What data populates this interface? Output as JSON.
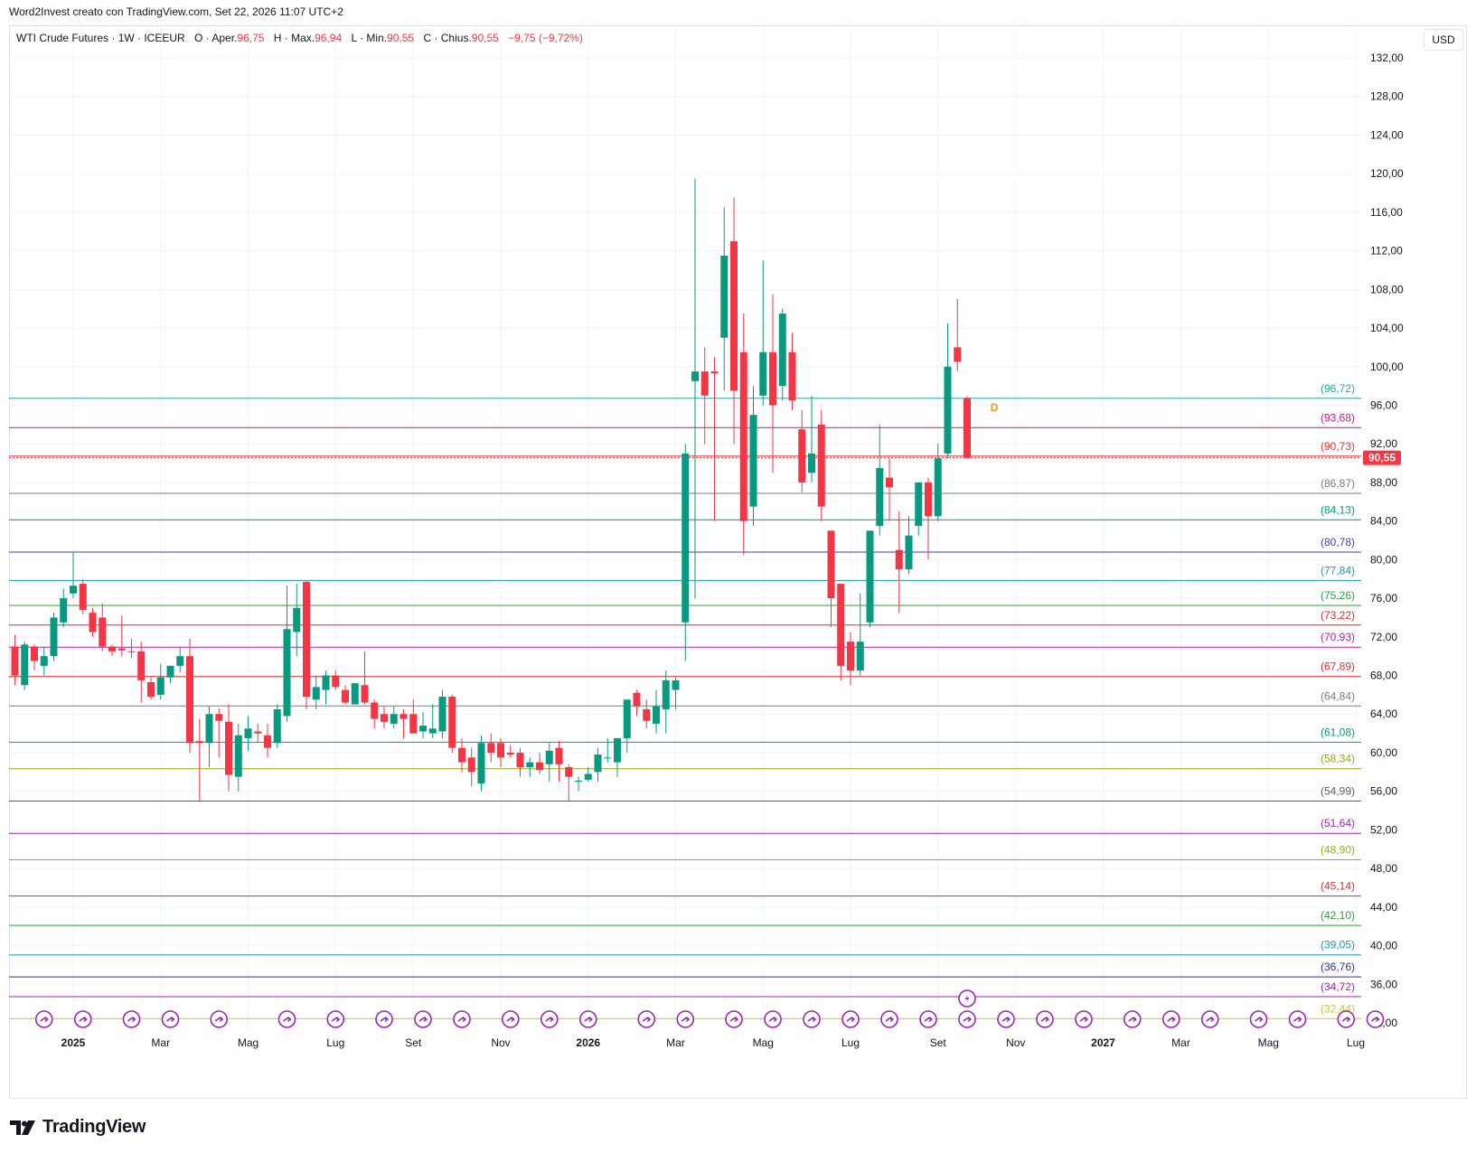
{
  "header": {
    "caption": "Word2Invest creato con TradingView.com, Set 22, 2026 11:07 UTC+2"
  },
  "legend": {
    "symbol": "WTI Crude Futures · 1W · ICEEUR",
    "open_label": "O · Aper.",
    "open_value": "96,75",
    "high_label": "H · Max.",
    "high_value": "96,94",
    "low_label": "L · Min.",
    "low_value": "90,55",
    "close_label": "C · Chius.",
    "close_value": "90,55",
    "change": "−9,75 (−9,72%)"
  },
  "currency": "USD",
  "brand": {
    "name": "TradingView"
  },
  "colors": {
    "up": "#089981",
    "down": "#f23645",
    "grid": "#f0f3fa",
    "text": "#131722",
    "marker": "#9c27b0",
    "current_price": "#f23645"
  },
  "chart_data": {
    "type": "candlestick",
    "title": "WTI Crude Futures · 1W · ICEEUR",
    "ylim": [
      32,
      134
    ],
    "y_ticks": [
      "32,00",
      "36,00",
      "40,00",
      "44,00",
      "48,00",
      "52,00",
      "56,00",
      "60,00",
      "64,00",
      "68,00",
      "72,00",
      "76,00",
      "80,00",
      "84,00",
      "88,00",
      "92,00",
      "96,00",
      "100,00",
      "104,00",
      "108,00",
      "112,00",
      "116,00",
      "120,00",
      "124,00",
      "128,00",
      "132,00"
    ],
    "y_tick_values": [
      32,
      36,
      40,
      44,
      48,
      52,
      56,
      60,
      64,
      68,
      72,
      76,
      80,
      84,
      88,
      92,
      96,
      100,
      104,
      108,
      112,
      116,
      120,
      124,
      128,
      132
    ],
    "x_ticks": [
      {
        "label": "2025",
        "week": 6,
        "bold": true
      },
      {
        "label": "Mar",
        "week": 15
      },
      {
        "label": "Mag",
        "week": 24
      },
      {
        "label": "Lug",
        "week": 33
      },
      {
        "label": "Set",
        "week": 41
      },
      {
        "label": "Nov",
        "week": 50
      },
      {
        "label": "2026",
        "week": 59,
        "bold": true
      },
      {
        "label": "Mar",
        "week": 68
      },
      {
        "label": "Mag",
        "week": 77
      },
      {
        "label": "Lug",
        "week": 86
      },
      {
        "label": "Set",
        "week": 95
      },
      {
        "label": "Nov",
        "week": 103
      },
      {
        "label": "2027",
        "week": 112,
        "bold": true
      },
      {
        "label": "Mar",
        "week": 120
      },
      {
        "label": "Mag",
        "week": 129
      },
      {
        "label": "Lug",
        "week": 138
      }
    ],
    "candles": [
      [
        71.0,
        72.2,
        67.0,
        68.0
      ],
      [
        67.0,
        71.5,
        66.5,
        71.2
      ],
      [
        71.0,
        71.2,
        68.5,
        69.5
      ],
      [
        69.0,
        71.0,
        68.0,
        70.0
      ],
      [
        70.0,
        74.5,
        69.5,
        74.0
      ],
      [
        73.5,
        77.0,
        73.0,
        76.0
      ],
      [
        76.5,
        80.8,
        76.0,
        77.3
      ],
      [
        77.5,
        78.0,
        74.3,
        74.8
      ],
      [
        74.5,
        75.0,
        72.0,
        72.5
      ],
      [
        74.0,
        75.5,
        70.5,
        71.0
      ],
      [
        71.0,
        71.2,
        70.0,
        70.5
      ],
      [
        70.8,
        74.2,
        70.0,
        70.6
      ],
      [
        70.5,
        71.8,
        69.8,
        70.4
      ],
      [
        70.5,
        71.5,
        65.2,
        67.5
      ],
      [
        67.3,
        67.8,
        65.5,
        65.8
      ],
      [
        66.0,
        69.2,
        65.5,
        67.8
      ],
      [
        67.8,
        69.0,
        67.2,
        69.0
      ],
      [
        69.0,
        71.0,
        68.3,
        70.0
      ],
      [
        70.0,
        71.8,
        60.0,
        61.0
      ],
      [
        61.2,
        63.5,
        55.0,
        61.0
      ],
      [
        61.0,
        64.8,
        58.5,
        64.0
      ],
      [
        64.0,
        64.6,
        59.5,
        63.3
      ],
      [
        63.2,
        65.0,
        56.0,
        57.7
      ],
      [
        57.5,
        63.0,
        56.0,
        61.8
      ],
      [
        61.5,
        63.8,
        60.2,
        62.5
      ],
      [
        62.2,
        63.0,
        61.0,
        62.0
      ],
      [
        61.8,
        63.0,
        59.5,
        60.5
      ],
      [
        61.0,
        65.0,
        60.5,
        64.5
      ],
      [
        63.8,
        77.3,
        63.2,
        72.8
      ],
      [
        72.5,
        77.5,
        70.0,
        75.0
      ],
      [
        77.7,
        77.8,
        64.5,
        65.8
      ],
      [
        65.5,
        68.0,
        64.5,
        66.8
      ],
      [
        66.5,
        68.5,
        65.0,
        68.0
      ],
      [
        68.0,
        68.5,
        66.5,
        66.8
      ],
      [
        66.5,
        67.0,
        65.0,
        65.2
      ],
      [
        65.0,
        67.0,
        65.0,
        67.2
      ],
      [
        67.0,
        70.5,
        65.0,
        65.2
      ],
      [
        65.2,
        65.5,
        62.5,
        63.5
      ],
      [
        64.0,
        64.8,
        62.5,
        63.2
      ],
      [
        63.0,
        64.8,
        62.5,
        64.0
      ],
      [
        64.0,
        64.5,
        61.5,
        63.5
      ],
      [
        64.0,
        65.5,
        62.0,
        62.0
      ],
      [
        62.2,
        64.2,
        61.5,
        62.8
      ],
      [
        62.0,
        65.0,
        61.5,
        62.5
      ],
      [
        62.2,
        66.5,
        61.5,
        65.8
      ],
      [
        65.8,
        66.0,
        60.0,
        60.5
      ],
      [
        60.5,
        61.5,
        58.0,
        59.0
      ],
      [
        59.5,
        60.5,
        56.5,
        58.0
      ],
      [
        56.8,
        61.8,
        56.0,
        61.0
      ],
      [
        61.0,
        62.0,
        59.0,
        60.0
      ],
      [
        61.0,
        61.5,
        58.5,
        59.5
      ],
      [
        60.0,
        60.8,
        59.5,
        59.8
      ],
      [
        60.0,
        60.5,
        57.5,
        58.5
      ],
      [
        58.5,
        59.5,
        57.5,
        59.0
      ],
      [
        59.0,
        60.0,
        57.8,
        58.2
      ],
      [
        58.8,
        61.0,
        57.0,
        60.2
      ],
      [
        60.5,
        61.2,
        57.0,
        58.8
      ],
      [
        58.5,
        58.8,
        55.0,
        57.5
      ],
      [
        57.0,
        57.5,
        56.0,
        57.1
      ],
      [
        57.2,
        58.5,
        57.0,
        57.8
      ],
      [
        58.0,
        60.5,
        57.0,
        59.8
      ],
      [
        59.5,
        61.5,
        59.0,
        59.5
      ],
      [
        59.0,
        61.5,
        57.5,
        61.5
      ],
      [
        61.5,
        65.0,
        60.0,
        65.5
      ],
      [
        66.2,
        66.5,
        63.8,
        64.8
      ],
      [
        64.5,
        65.5,
        62.5,
        63.3
      ],
      [
        63.0,
        66.5,
        62.0,
        64.8
      ],
      [
        64.5,
        68.5,
        62.0,
        67.5
      ],
      [
        66.5,
        67.8,
        64.5,
        67.5
      ],
      [
        73.5,
        92.0,
        69.5,
        91.0
      ],
      [
        98.5,
        119.5,
        76.0,
        99.5
      ],
      [
        99.5,
        102.0,
        92.0,
        97.0
      ],
      [
        99.5,
        101.0,
        84.0,
        99.3
      ],
      [
        103.0,
        116.5,
        97.5,
        111.5
      ],
      [
        113.0,
        117.5,
        92.0,
        97.5
      ],
      [
        101.5,
        105.5,
        80.5,
        84.0
      ],
      [
        85.5,
        98.0,
        83.5,
        95.0
      ],
      [
        97.0,
        111.0,
        96.0,
        101.5
      ],
      [
        101.5,
        107.5,
        89.0,
        96.0
      ],
      [
        98.0,
        106.0,
        96.5,
        105.5
      ],
      [
        101.5,
        103.5,
        95.5,
        96.5
      ],
      [
        93.5,
        95.5,
        87.0,
        88.0
      ],
      [
        89.0,
        97.0,
        88.0,
        91.0
      ],
      [
        94.0,
        95.5,
        84.0,
        85.5
      ],
      [
        83.0,
        82.5,
        73.0,
        76.0
      ],
      [
        77.5,
        77.0,
        67.5,
        69.0
      ],
      [
        71.5,
        72.5,
        67.0,
        68.5
      ],
      [
        68.5,
        76.5,
        68.0,
        71.5
      ],
      [
        73.5,
        83.0,
        73.0,
        83.0
      ],
      [
        83.5,
        94.0,
        82.5,
        89.5
      ],
      [
        88.5,
        90.5,
        84.0,
        87.5
      ],
      [
        81.0,
        85.0,
        74.5,
        79.0
      ],
      [
        79.0,
        84.5,
        78.5,
        82.5
      ],
      [
        83.5,
        88.0,
        82.5,
        88.0
      ],
      [
        88.0,
        88.5,
        80.0,
        84.5
      ],
      [
        84.5,
        92.0,
        84.0,
        90.5
      ],
      [
        91.0,
        104.5,
        90.5,
        100.0
      ],
      [
        102.0,
        107.0,
        99.5,
        100.5
      ],
      [
        96.75,
        96.94,
        90.55,
        90.55
      ]
    ],
    "levels": [
      {
        "value": 96.72,
        "label": "(96,72)",
        "color": "#26a69a"
      },
      {
        "value": 93.68,
        "label": "(93,68)",
        "color": "#b71c8e"
      },
      {
        "value": 90.73,
        "label": "(90,73)",
        "color": "#e53935"
      },
      {
        "value": 86.87,
        "label": "(86,87)",
        "color": "#787b86"
      },
      {
        "value": 84.13,
        "label": "(84,13)",
        "color": "#089981"
      },
      {
        "value": 80.78,
        "label": "(80,78)",
        "color": "#3f3fbf"
      },
      {
        "value": 77.84,
        "label": "(77,84)",
        "color": "#2196b3"
      },
      {
        "value": 75.26,
        "label": "(75,26)",
        "color": "#2e9e3e"
      },
      {
        "value": 73.22,
        "label": "(73,22)",
        "color": "#d32f2f"
      },
      {
        "value": 70.93,
        "label": "(70,93)",
        "color": "#b71cab"
      },
      {
        "value": 67.89,
        "label": "(67,89)",
        "color": "#d32f2f"
      },
      {
        "value": 64.84,
        "label": "(64,84)",
        "color": "#787b86"
      },
      {
        "value": 61.08,
        "label": "(61,08)",
        "color": "#089981"
      },
      {
        "value": 58.34,
        "label": "(58,34)",
        "color": "#9aa815"
      },
      {
        "value": 54.99,
        "label": "(54,99)",
        "color": "#5d606b"
      },
      {
        "value": 51.64,
        "label": "(51,64)",
        "color": "#9c27b0"
      },
      {
        "value": 48.9,
        "label": "(48,90)",
        "color": "#8bb31a"
      },
      {
        "value": 45.14,
        "label": "(45,14)",
        "color": "#d32f2f"
      },
      {
        "value": 42.1,
        "label": "(42,10)",
        "color": "#2e9e3e"
      },
      {
        "value": 39.05,
        "label": "(39,05)",
        "color": "#2196b3"
      },
      {
        "value": 36.76,
        "label": "(36,76)",
        "color": "#283593"
      },
      {
        "value": 34.72,
        "label": "(34,72)",
        "color": "#9c27b0"
      },
      {
        "value": 32.44,
        "label": "(32,44)",
        "color": "#c0ca33"
      }
    ],
    "current_price": {
      "value": 90.55,
      "label": "90,55"
    },
    "event_markers_weeks": [
      3,
      7,
      12,
      16,
      21,
      28,
      33,
      38,
      42,
      46,
      51,
      55,
      59,
      65,
      69,
      74,
      78,
      82,
      86,
      90,
      94,
      98,
      102,
      106,
      110,
      115,
      119,
      123,
      128,
      132,
      137,
      140
    ],
    "special_marker_week": 98,
    "dividend_label": "D",
    "dividend_week": 100.8
  }
}
